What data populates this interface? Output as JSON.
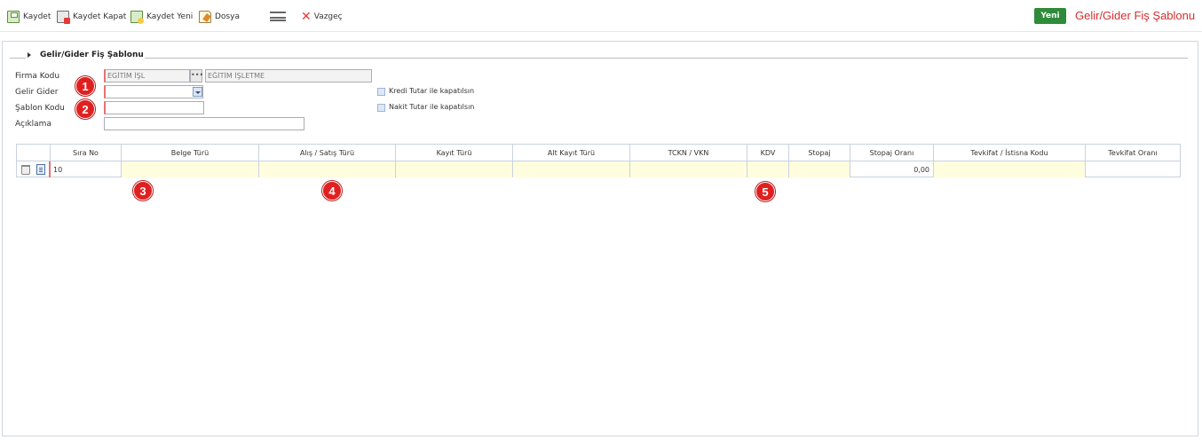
{
  "toolbar": {
    "save_label": "Kaydet",
    "save_close_label": "Kaydet Kapat",
    "save_new_label": "Kaydet Yeni",
    "file_label": "Dosya",
    "cancel_label": "Vazgeç",
    "new_label": "Yeni",
    "title": "Gelir/Gider Fiş Şablonu"
  },
  "form": {
    "section_title": "Gelir/Gider Fiş Şablonu",
    "firma_kodu_label": "Firma Kodu",
    "firma_kodu_value": "EGİTİM İŞL",
    "firma_adi_value": "EĞİTİM İŞLETME",
    "gelir_gider_label": "Gelir Gider",
    "gelir_gider_value": "",
    "sablon_kodu_label": "Şablon Kodu",
    "sablon_kodu_value": "",
    "aciklama_label": "Açıklama",
    "aciklama_value": "",
    "lookup_glyph": "•••",
    "kredi_label": "Kredi Tutar ile kapatılsın",
    "nakit_label": "Nakit Tutar ile kapatılsın"
  },
  "grid": {
    "columns": [
      "Sıra No",
      "Belge Türü",
      "Alış / Satış Türü",
      "Kayıt Türü",
      "Alt Kayıt Türü",
      "TCKN / VKN",
      "KDV",
      "Stopaj",
      "Stopaj Oranı",
      "Tevkifat / İstisna Kodu",
      "Tevkifat Oranı"
    ],
    "row": {
      "sira_no": "10",
      "belge_turu": "",
      "alis_satis_turu": "",
      "kayit_turu": "",
      "alt_kayit_turu": "",
      "tckn_vkn": "",
      "kdv": "",
      "stopaj": "",
      "stopaj_orani": "0,00",
      "tevkifat_kodu": "",
      "tevkifat_orani": ""
    }
  },
  "annotations": [
    "1",
    "2",
    "3",
    "4",
    "5"
  ],
  "colors": {
    "accent_red": "#e02020",
    "new_button": "#2e8b3a",
    "editable_cell": "#fefedf"
  }
}
